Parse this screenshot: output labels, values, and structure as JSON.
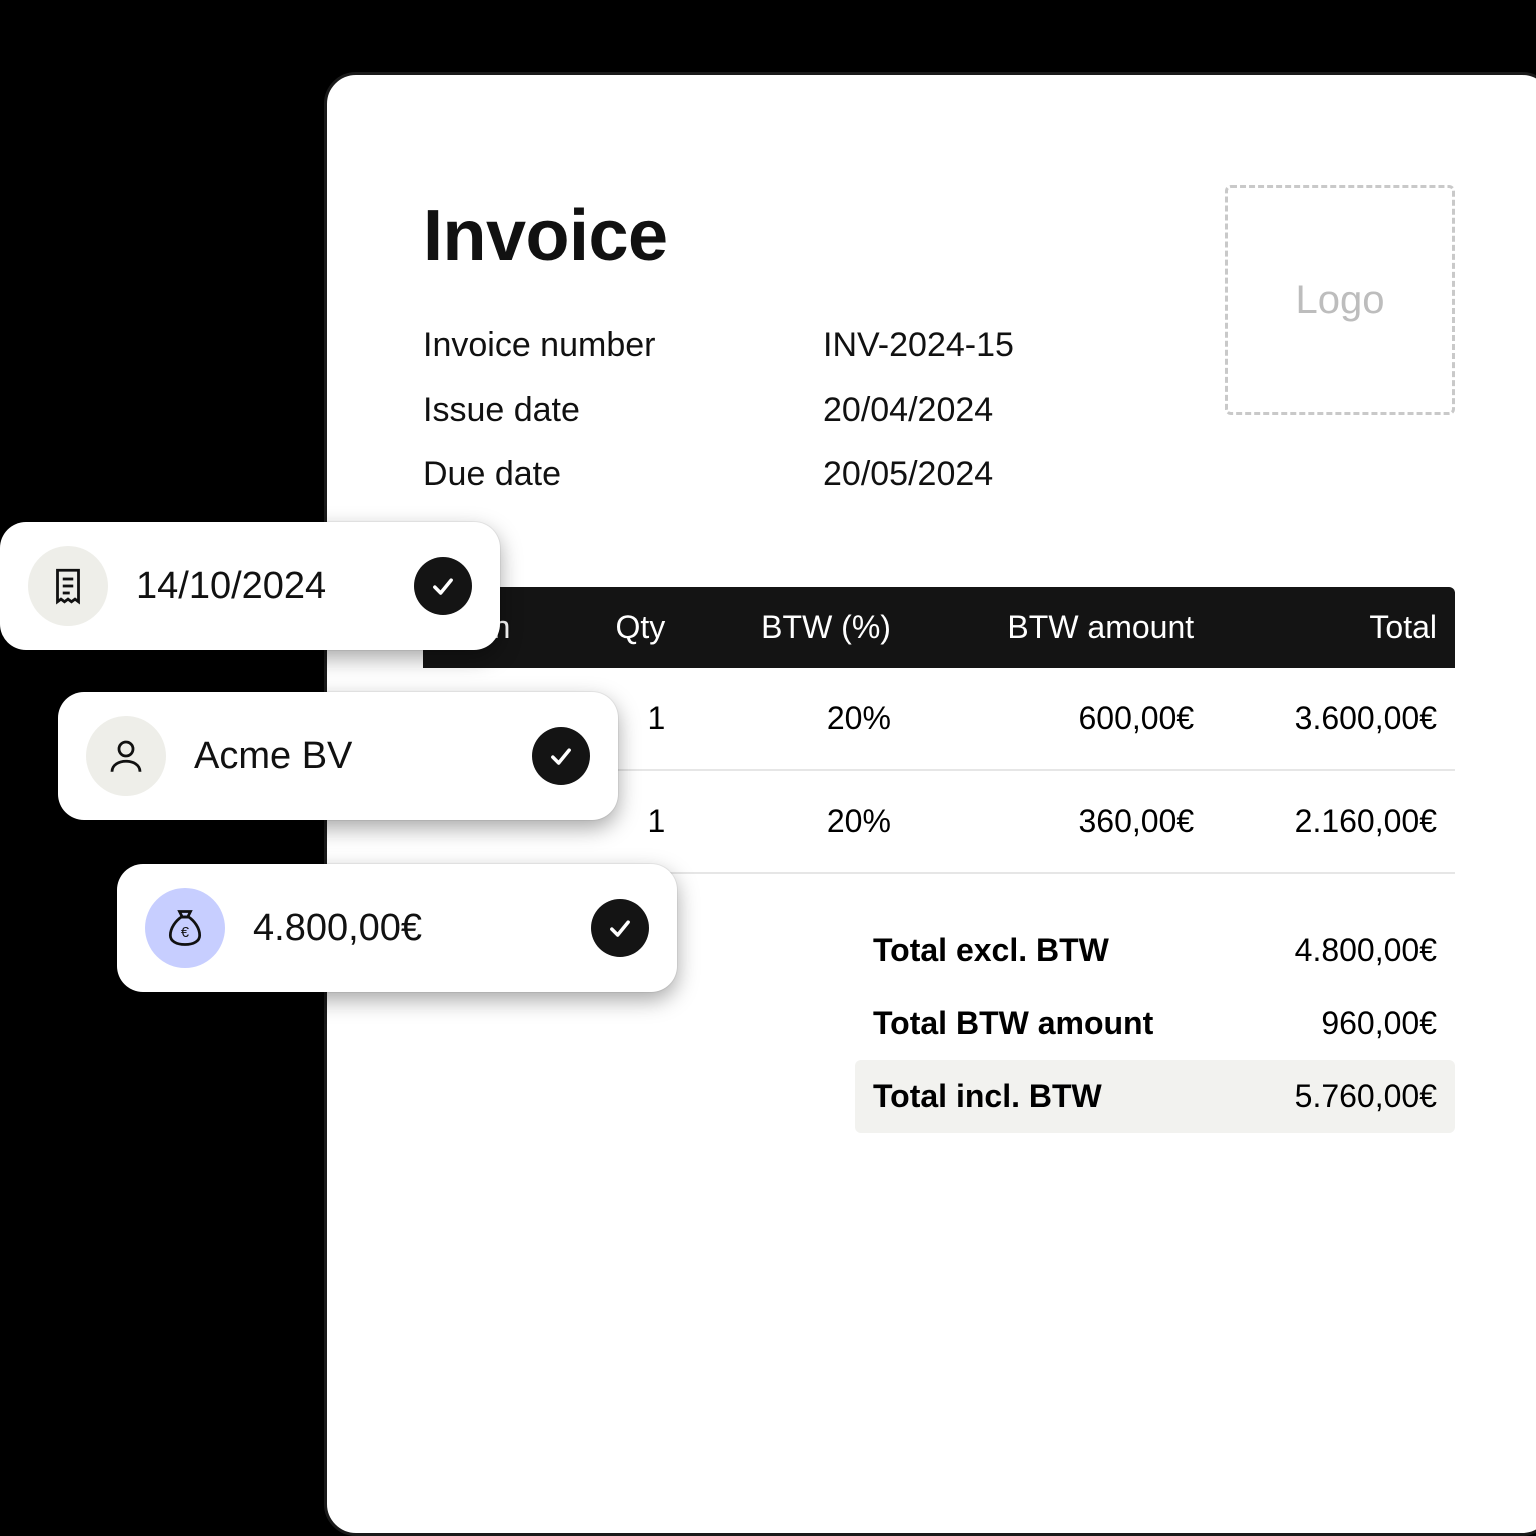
{
  "invoice": {
    "title": "Invoice",
    "logo_placeholder": "Logo",
    "meta": {
      "number_label": "Invoice number",
      "number_value": "INV-2024-15",
      "issue_label": "Issue date",
      "issue_value": "20/04/2024",
      "due_label": "Due date",
      "due_value": "20/05/2024"
    },
    "table": {
      "headers": {
        "desc": "ption",
        "qty": "Qty",
        "btw_pct": "BTW (%)",
        "btw_amt": "BTW amount",
        "total": "Total"
      },
      "rows": [
        {
          "desc": "",
          "qty": "1",
          "btw_pct": "20%",
          "btw_amt": "600,00€",
          "total": "3.600,00€"
        },
        {
          "desc": "",
          "qty": "1",
          "btw_pct": "20%",
          "btw_amt": "360,00€",
          "total": "2.160,00€"
        }
      ]
    },
    "totals": {
      "excl_label": "Total excl. BTW",
      "excl_value": "4.800,00€",
      "btw_label": "Total BTW amount",
      "btw_value": "960,00€",
      "incl_label": "Total incl. BTW",
      "incl_value": "5.760,00€"
    }
  },
  "pills": {
    "date": {
      "text": "14/10/2024"
    },
    "client": {
      "text": "Acme BV"
    },
    "amount": {
      "text": "4.800,00€"
    }
  }
}
